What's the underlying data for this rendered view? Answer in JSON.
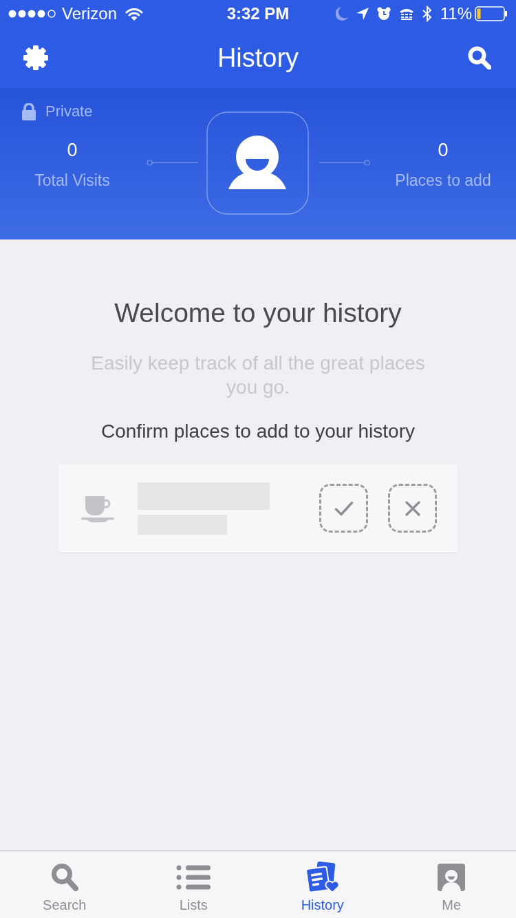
{
  "status_bar": {
    "carrier": "Verizon",
    "time": "3:32 PM",
    "battery": "11%"
  },
  "nav_bar": {
    "title": "History"
  },
  "header": {
    "privacy": "Private",
    "stats": [
      {
        "value": "0",
        "label": "Total Visits"
      },
      {
        "value": "0",
        "label": "Places to add"
      }
    ]
  },
  "empty_state": {
    "title": "Welcome to your history",
    "subtitle": "Easily keep track of all the great places you go.",
    "prompt": "Confirm places to add to your history"
  },
  "tab_bar": [
    {
      "kind": "search",
      "label": "Search",
      "selected": false
    },
    {
      "kind": "lists",
      "label": "Lists",
      "selected": false
    },
    {
      "kind": "history",
      "label": "History",
      "selected": true
    },
    {
      "kind": "me",
      "label": "Me",
      "selected": false
    }
  ]
}
